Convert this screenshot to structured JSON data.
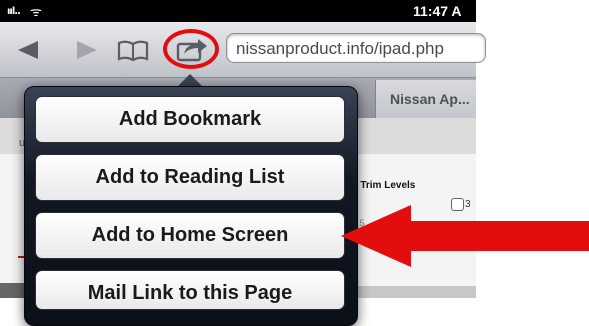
{
  "status_bar": {
    "signal": "ııl..",
    "wifi": "ᯤ",
    "time": "11:47 A"
  },
  "toolbar": {
    "url": "nissanproduct.info/ipad.php"
  },
  "tab": {
    "label": "Nissan Ap..."
  },
  "page": {
    "trim_levels": "ll Trim Levels",
    "heading_fragment": "s",
    "left_fragment": "u",
    "val1": "5",
    "val2": "5.5",
    "checkbox_text": "3"
  },
  "share_menu": {
    "items": [
      {
        "label": "Add Bookmark"
      },
      {
        "label": "Add to Reading List"
      },
      {
        "label": "Add to Home Screen"
      },
      {
        "label": "Mail Link to this Page"
      }
    ]
  },
  "colors": {
    "annotation_red": "#e30d0d",
    "popover_dark": "#121722"
  }
}
